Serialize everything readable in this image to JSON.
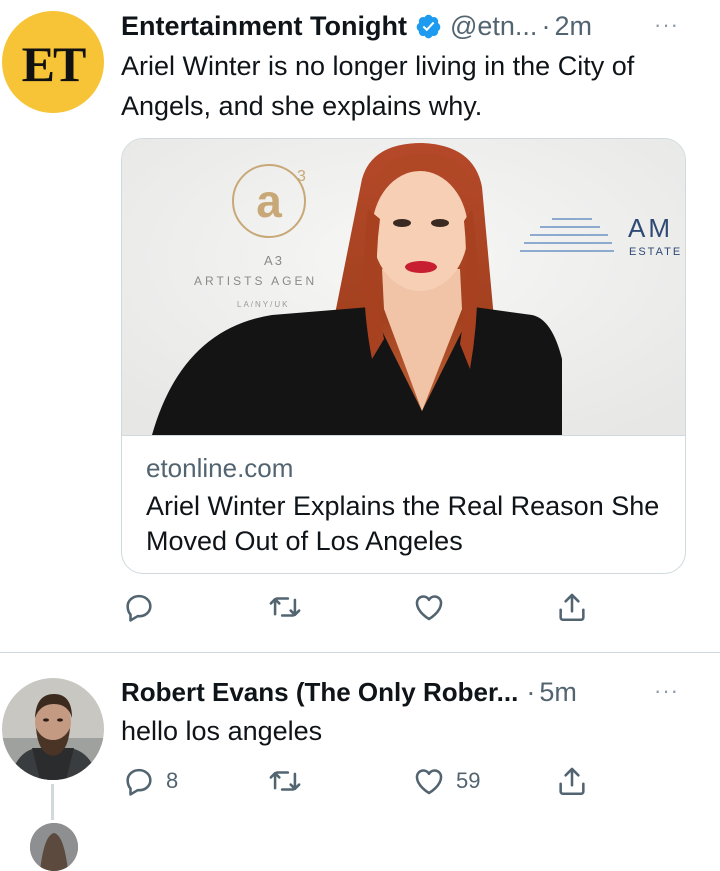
{
  "tweets": [
    {
      "avatar": {
        "text": "ET",
        "bg": "#f7c437"
      },
      "name": "Entertainment Tonight",
      "verified": true,
      "handle": "@etn...",
      "sep": "·",
      "time": "2m",
      "more": "···",
      "text": "Ariel Winter is no longer living in the City of Angels, and she explains why.",
      "card": {
        "domain": "etonline.com",
        "title": "Ariel Winter Explains the Real Reason She Moved Out of Los Angeles",
        "image_backdrop": {
          "logo_mark": "a",
          "logo_sup": "3",
          "brand": "A3",
          "brand_sub": "ARTISTS AGEN",
          "brand_loc": "LA/NY/UK",
          "sponsor_1": "AM",
          "sponsor_2": "ESTATE"
        }
      },
      "actions": {
        "reply": "",
        "retweet": "",
        "like": "",
        "share": ""
      }
    },
    {
      "name": "Robert Evans (The Only Rober...",
      "verified": false,
      "sep": "·",
      "time": "5m",
      "more": "···",
      "text": "hello los angeles",
      "actions": {
        "reply": "8",
        "retweet": "",
        "like": "59",
        "share": ""
      }
    }
  ],
  "colors": {
    "text": "#0f1419",
    "secondary": "#536471",
    "border": "#cfd9de",
    "verified": "#1d9bf0",
    "et_yellow": "#f7c437"
  }
}
